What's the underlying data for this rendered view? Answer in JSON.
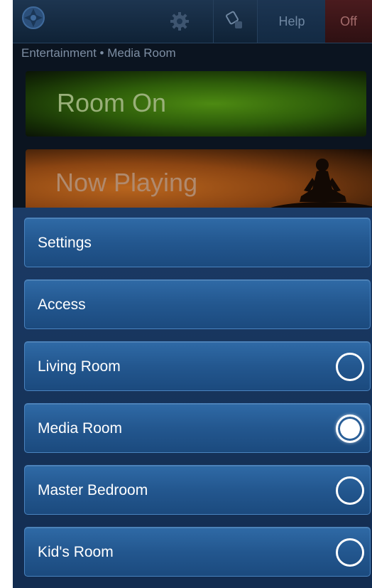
{
  "topbar": {
    "icons": [
      "app-logo-icon",
      "gear-icon",
      "remote-icon"
    ],
    "help_label": "Help",
    "off_label": "Off"
  },
  "breadcrumb": "Entertainment • Media Room",
  "tiles": {
    "room_on": "Room On",
    "now_playing": "Now Playing"
  },
  "menu": {
    "settings": "Settings",
    "access": "Access",
    "rooms": [
      {
        "label": "Living Room",
        "selected": false
      },
      {
        "label": "Media Room",
        "selected": true
      },
      {
        "label": "Master Bedroom",
        "selected": false
      },
      {
        "label": "Kid's Room",
        "selected": false
      }
    ]
  },
  "colors": {
    "room_on_accent": "#4d8a12",
    "now_playing_accent": "#b8651e",
    "menu_button": "#2a62a0",
    "off_button": "#4a1b1e"
  }
}
